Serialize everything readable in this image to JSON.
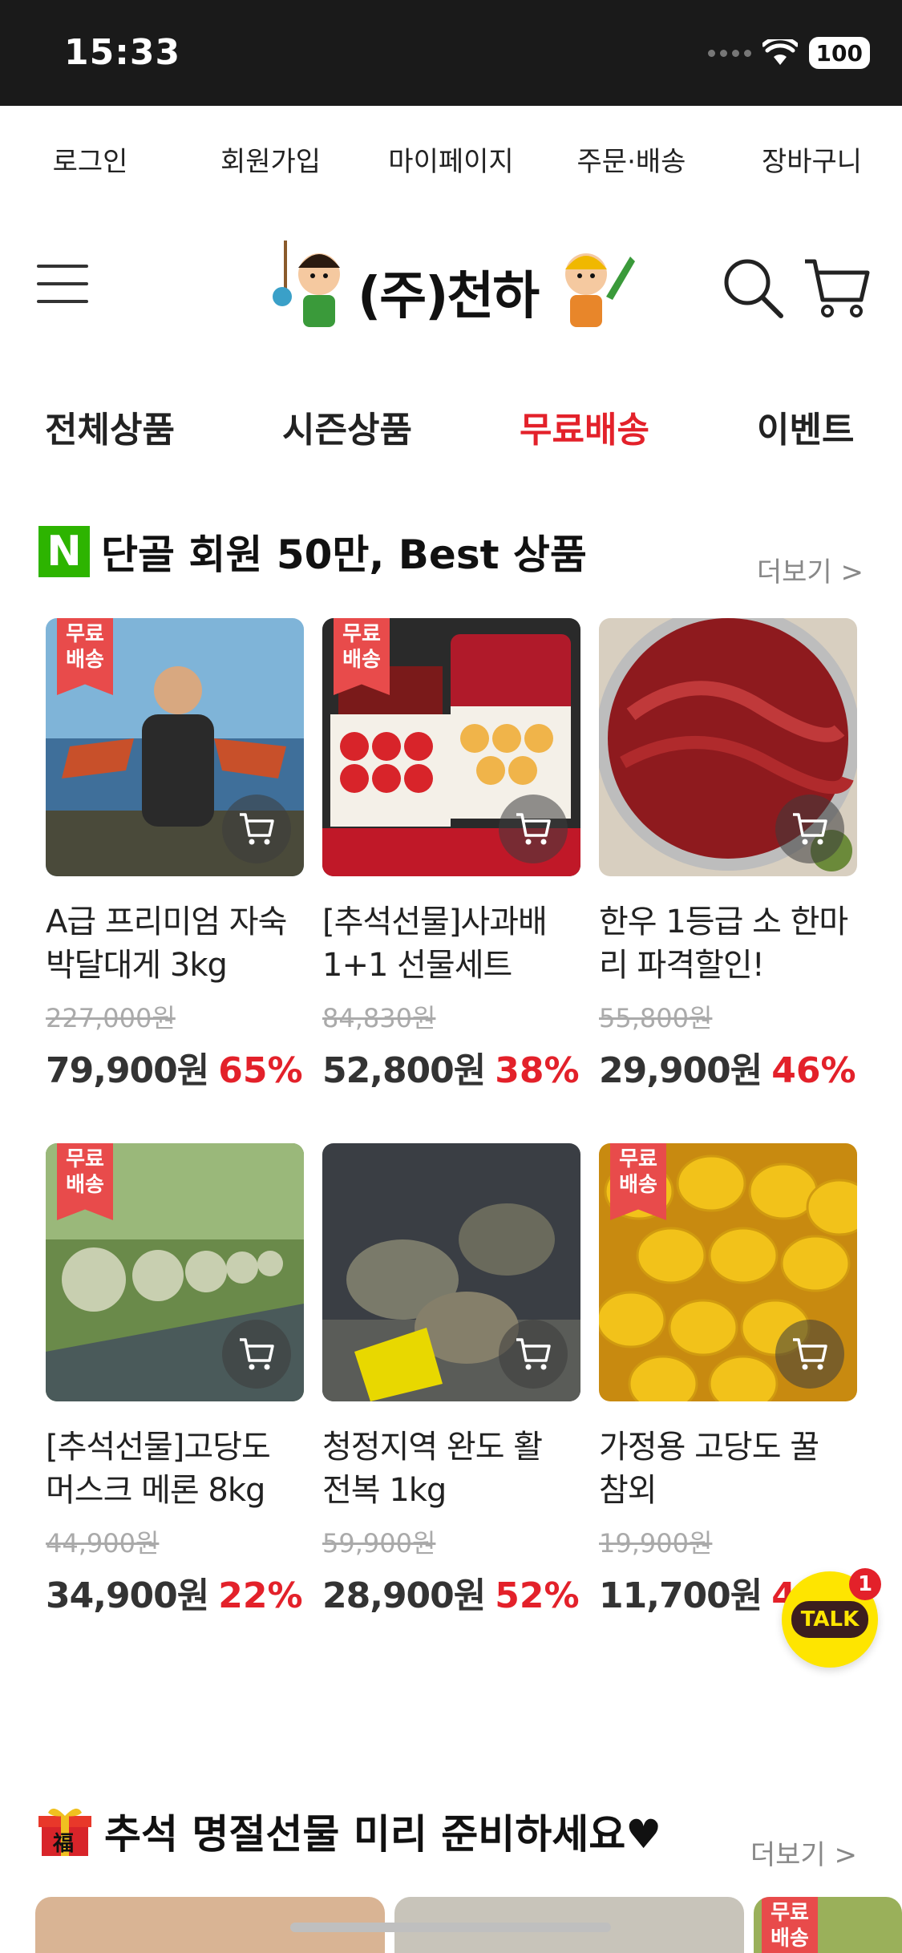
{
  "status_bar": {
    "time": "15:33",
    "battery": "100"
  },
  "top_links": [
    "로그인",
    "회원가입",
    "마이페이지",
    "주문·배송",
    "장바구니"
  ],
  "logo": {
    "text": "(주)천하"
  },
  "categories": [
    {
      "label": "전체상품",
      "active": false
    },
    {
      "label": "시즌상품",
      "active": false
    },
    {
      "label": "무료배송",
      "active": true
    },
    {
      "label": "이벤트",
      "active": false
    }
  ],
  "best_section": {
    "badge": "N",
    "title": "단골 회원 50만, Best 상품",
    "more": "더보기 >"
  },
  "products": [
    {
      "name_line1": "A급 프리미엄 자숙",
      "name_line2": "박달대게 3kg",
      "original_price": "227,000원",
      "price": "79,900원",
      "discount": "65%",
      "free_shipping": "무료 배송"
    },
    {
      "name_line1": "[추석선물]사과배",
      "name_line2": "1+1 선물세트",
      "original_price": "84,830원",
      "price": "52,800원",
      "discount": "38%",
      "free_shipping": "무료 배송"
    },
    {
      "name_line1": "한우 1등급 소 한마",
      "name_line2": "리 파격할인!",
      "original_price": "55,800원",
      "price": "29,900원",
      "discount": "46%",
      "free_shipping": ""
    },
    {
      "name_line1": "[추석선물]고당도",
      "name_line2": "머스크 메론 8kg",
      "original_price": "44,900원",
      "price": "34,900원",
      "discount": "22%",
      "free_shipping": "무료 배송"
    },
    {
      "name_line1": "청정지역 완도 활",
      "name_line2": "전복 1kg",
      "original_price": "59,900원",
      "price": "28,900원",
      "discount": "52%",
      "free_shipping": ""
    },
    {
      "name_line1": "가정용 고당도 꿀",
      "name_line2": "참외",
      "original_price": "19,900원",
      "price": "11,700원",
      "discount": "41%",
      "free_shipping": "무료 배송"
    }
  ],
  "talk_button": {
    "label": "TALK",
    "count": "1"
  },
  "gift_section": {
    "title": "추석 명절선물 미리 준비하세요♥",
    "more": "더보기 >",
    "gift_icon_text": "福"
  },
  "bottom_cards": [
    {
      "free_shipping": ""
    },
    {
      "free_shipping": ""
    },
    {
      "free_shipping": "무료 배송"
    }
  ],
  "colors": {
    "accent": "#e3212a",
    "badge_green": "#2db400",
    "free_tag": "#e84b4b",
    "talk_yellow": "#fee500"
  }
}
